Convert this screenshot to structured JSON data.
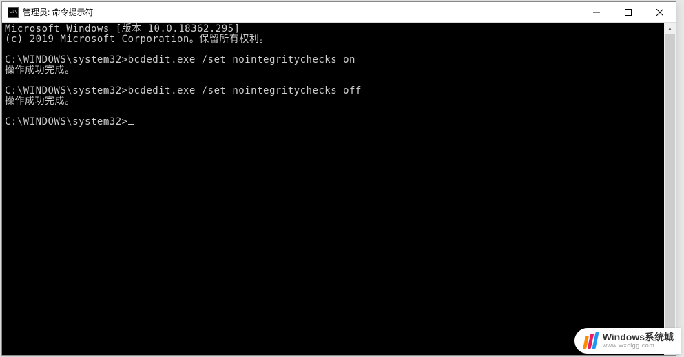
{
  "window": {
    "icon_text": "C:\\",
    "title": "管理员: 命令提示符"
  },
  "terminal": {
    "line1": "Microsoft Windows [版本 10.0.18362.295]",
    "line2": "(c) 2019 Microsoft Corporation。保留所有权利。",
    "blank1": "",
    "prompt1_path": "C:\\WINDOWS\\system32>",
    "prompt1_cmd": "bcdedit.exe /set nointegritychecks on",
    "result1": "操作成功完成。",
    "blank2": "",
    "prompt2_path": "C:\\WINDOWS\\system32>",
    "prompt2_cmd": "bcdedit.exe /set nointegritychecks off",
    "result2": "操作成功完成。",
    "blank3": "",
    "prompt3_path": "C:\\WINDOWS\\system32>"
  },
  "watermark": {
    "title": "Windows系统城",
    "url": "www.wxclgg.com"
  }
}
